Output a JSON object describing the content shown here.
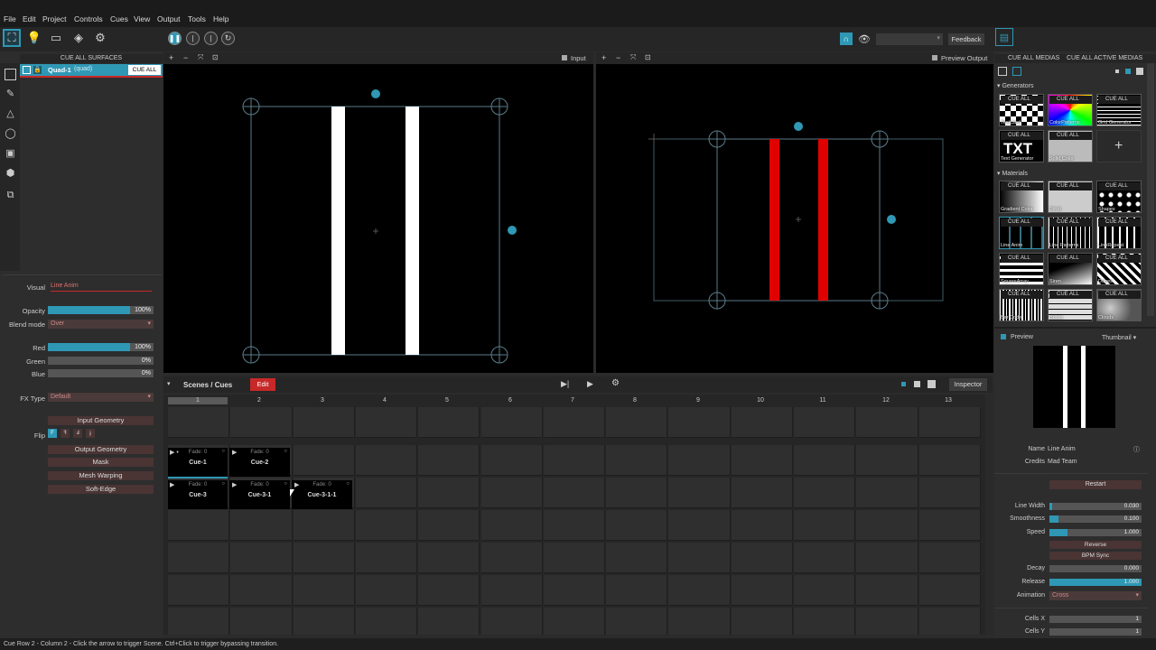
{
  "menu": [
    "File",
    "Edit",
    "Project",
    "Controls",
    "Cues",
    "View",
    "Output",
    "Tools",
    "Help"
  ],
  "toolbar": {
    "feedback": "Feedback"
  },
  "surfaces": {
    "cue_all": "CUE ALL SURFACES",
    "item_name": "Quad-1",
    "item_type": "(quad)",
    "item_cue": "CUE ALL"
  },
  "props": {
    "visual_label": "Visual",
    "visual_value": "Line Anim",
    "opacity_label": "Opacity",
    "opacity_value": "100%",
    "blend_label": "Blend mode",
    "blend_value": "Over",
    "red_label": "Red",
    "red_value": "100%",
    "green_label": "Green",
    "green_value": "0%",
    "blue_label": "Blue",
    "blue_value": "0%",
    "fx_label": "FX Type",
    "fx_value": "Default",
    "flip_label": "Flip",
    "input_geometry": "Input Geometry",
    "output_geometry": "Output Geometry",
    "mask": "Mask",
    "mesh_warping": "Mesh Warping",
    "soft_edge": "Soft-Edge"
  },
  "viewports": {
    "input_label": "Input",
    "output_label": "Preview Output"
  },
  "scenes": {
    "title": "Scenes / Cues",
    "edit": "Edit",
    "inspector": "Inspector",
    "columns": [
      "1",
      "2",
      "3",
      "4",
      "5",
      "6",
      "7",
      "8",
      "9",
      "10",
      "11",
      "12",
      "13"
    ],
    "cues": [
      {
        "fade": "Fade: 0",
        "name": "Cue-1"
      },
      {
        "fade": "Fade: 0",
        "name": "Cue-2"
      },
      {
        "fade": "Fade: 0",
        "name": "Cue-3"
      },
      {
        "fade": "Fade: 0",
        "name": "Cue-3-1"
      },
      {
        "fade": "Fade: 0",
        "name": "Cue-3-1-1"
      }
    ]
  },
  "status": "Cue Row 2 - Column 2 - Click the arrow to trigger Scene. Ctrl+Click to trigger bypassing transition.",
  "media": {
    "cue_all_medias": "CUE ALL MEDIAS",
    "cue_all_active": "CUE ALL ACTIVE MEDIAS",
    "generators_label": "Generators",
    "materials_label": "Materials",
    "cue_all": "CUE ALL",
    "generators": [
      "TestCard",
      "ColorPatterns",
      "Grid Generator",
      "Text Generator",
      "Solid Color"
    ],
    "materials": [
      "Gradient Color",
      "Strob",
      "Shapes",
      "Line Anim",
      "Line Patterns",
      "LineRepeat",
      "SquareArray",
      "Siren",
      "Dunes",
      "Bar Code",
      "Bricks",
      "Clouds"
    ],
    "txt": "TXT"
  },
  "preview": {
    "label": "Preview",
    "mode": "Thumbnail",
    "name_label": "Name",
    "name_value": "Line Anim",
    "credits_label": "Credits",
    "credits_value": "Mad Team",
    "restart": "Restart",
    "params": [
      {
        "label": "Line Width",
        "value": "0.030",
        "frac": 0.03
      },
      {
        "label": "Smoothness",
        "value": "0.100",
        "frac": 0.1
      },
      {
        "label": "Speed",
        "value": "1.000",
        "frac": 0.2
      }
    ],
    "reverse": "Reverse",
    "bpm_sync": "BPM Sync",
    "params2": [
      {
        "label": "Decay",
        "value": "0.000",
        "frac": 0
      },
      {
        "label": "Release",
        "value": "1.000",
        "frac": 1
      }
    ],
    "animation_label": "Animation",
    "animation_value": "Cross",
    "cells_x_label": "Cells X",
    "cells_x_value": "1",
    "cells_y_label": "Cells Y",
    "cells_y_value": "1"
  },
  "colors": {
    "accent": "#2f98b5",
    "red_line": "#e00000",
    "edit_red": "#c82828"
  }
}
